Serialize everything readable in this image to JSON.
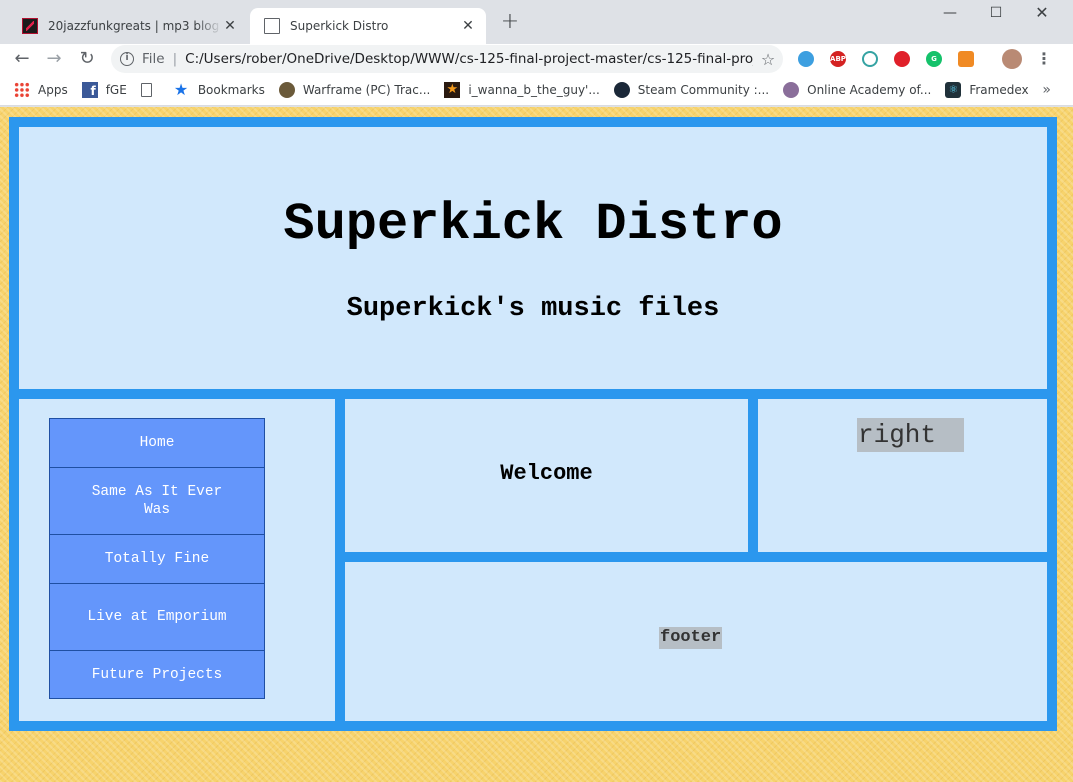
{
  "browser": {
    "tabs": [
      {
        "title": "20jazzfunkgreats | mp3 blog fanzi",
        "close": "✕"
      },
      {
        "title": "Superkick Distro",
        "close": "✕"
      }
    ],
    "new_tab": "+",
    "window_controls": {
      "minimize": "—",
      "maximize": "☐",
      "close": "✕"
    },
    "toolbar": {
      "back": "←",
      "forward": "→",
      "reload": "↻",
      "info": "i",
      "scheme": "File",
      "url": "C:/Users/rober/OneDrive/Desktop/WWW/cs-125-final-project-master/cs-125-final-projec...",
      "star": "☆",
      "menu": "⋮",
      "extensions": [
        "ghostery-icon",
        "adblock-icon",
        "shield-icon",
        "stop-icon",
        "grammarly-icon",
        "privacy-badger-icon",
        "profile-avatar"
      ]
    },
    "bookmarks": [
      {
        "label": "Apps",
        "icon": "apps-grid-icon"
      },
      {
        "label": "fGE",
        "icon": "facebook-icon"
      },
      {
        "label": "",
        "icon": "page-icon"
      },
      {
        "label": "Bookmarks",
        "icon": "star-icon"
      },
      {
        "label": "Warframe (PC) Trac...",
        "icon": "warframe-icon"
      },
      {
        "label": "i_wanna_b_the_guy'...",
        "icon": "star-badge-icon"
      },
      {
        "label": "Steam Community :...",
        "icon": "steam-icon"
      },
      {
        "label": "Online Academy of...",
        "icon": "academy-icon"
      },
      {
        "label": "Framedex",
        "icon": "framedex-icon"
      }
    ],
    "bookmarks_more": "»"
  },
  "page": {
    "title": "Superkick Distro",
    "subtitle": "Superkick's music files",
    "nav": [
      {
        "label": "Home"
      },
      {
        "label": "Same As It Ever Was"
      },
      {
        "label": "Totally Fine"
      },
      {
        "label": "Live at Emporium"
      },
      {
        "label": "Future Projects"
      }
    ],
    "main_text": "Welcome",
    "right_text": "right",
    "footer_text": "footer"
  },
  "colors": {
    "grid_border": "#2b97ee",
    "cell_bg": "#d1e8fc",
    "nav_item_bg": "#6496fb",
    "label_highlight": "#b6bec5",
    "page_bg": "#f7d36c"
  }
}
